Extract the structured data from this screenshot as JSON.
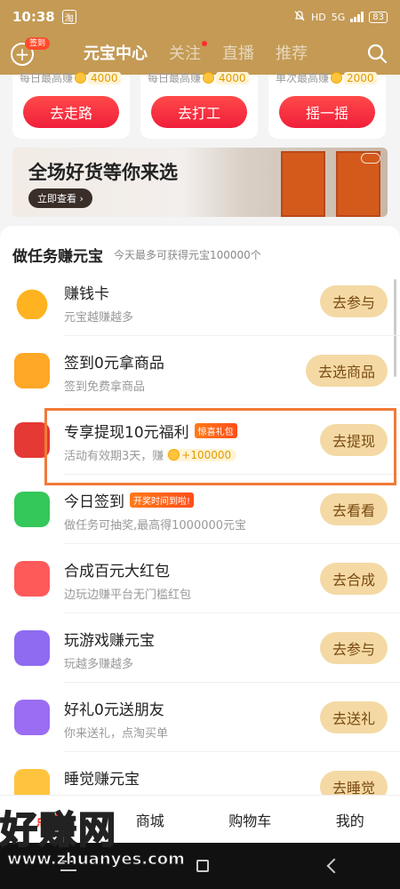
{
  "status_bar": {
    "time": "10:38",
    "app_badge": "淘",
    "net": "5G",
    "battery": "83",
    "hd": "HD"
  },
  "header": {
    "sign_badge": "签到",
    "tabs": [
      {
        "label": "元宝中心"
      },
      {
        "label": "关注"
      },
      {
        "label": "直播"
      },
      {
        "label": "推荐"
      }
    ]
  },
  "top_cards": [
    {
      "label": "每日最高赚",
      "amount": "4000",
      "button": "去走路"
    },
    {
      "label": "每日最高赚",
      "amount": "4000",
      "button": "去打工"
    },
    {
      "label": "单次最高赚",
      "amount": "2000",
      "button": "摇一摇"
    }
  ],
  "banner": {
    "title": "全场好货等你来选",
    "button": "立即查看 ›"
  },
  "tasks_section": {
    "title": "做任务赚元宝",
    "subtitle": "今天最多可获得元宝100000个",
    "items": [
      {
        "icon": "gold-ingot-icon",
        "name": "赚钱卡",
        "desc": "元宝越赚越多",
        "action": "去参与"
      },
      {
        "icon": "calendar-check-icon",
        "name": "签到0元拿商品",
        "desc": "签到免费拿商品",
        "action": "去选商品"
      },
      {
        "icon": "red-envelope-icon",
        "name": "专享提现10元福利",
        "tag": "惊喜礼包",
        "desc": "活动有效期3天，赚",
        "reward": "+100000",
        "action": "去提现"
      },
      {
        "icon": "checkin-icon",
        "name": "今日签到",
        "tag": "开奖时间到啦!",
        "desc": "做任务可抽奖,最高得1000000元宝",
        "action": "去看看"
      },
      {
        "icon": "red-packet-14-icon",
        "name": "合成百元大红包",
        "desc": "边玩边赚平台无门槛红包",
        "action": "去合成"
      },
      {
        "icon": "gamepad-icon",
        "name": "玩游戏赚元宝",
        "desc": "玩越多赚越多",
        "action": "去参与"
      },
      {
        "icon": "gift-box-icon",
        "name": "好礼0元送朋友",
        "desc": "你来送礼，点淘买单",
        "action": "去送礼"
      },
      {
        "icon": "moon-icon",
        "name": "睡觉赚元宝",
        "action": "去睡觉"
      }
    ]
  },
  "bottom_nav": [
    {
      "label": "点淘"
    },
    {
      "label": "商城"
    },
    {
      "label": "购物车"
    },
    {
      "label": "我的"
    }
  ],
  "watermark": {
    "brand": "好赚网",
    "url": "www.zhuanyes.com"
  },
  "colors": {
    "header": "#c49a55",
    "primary_red": "#f01e3a",
    "action_bg": "#f4d9a4",
    "highlight": "#f07a38"
  }
}
